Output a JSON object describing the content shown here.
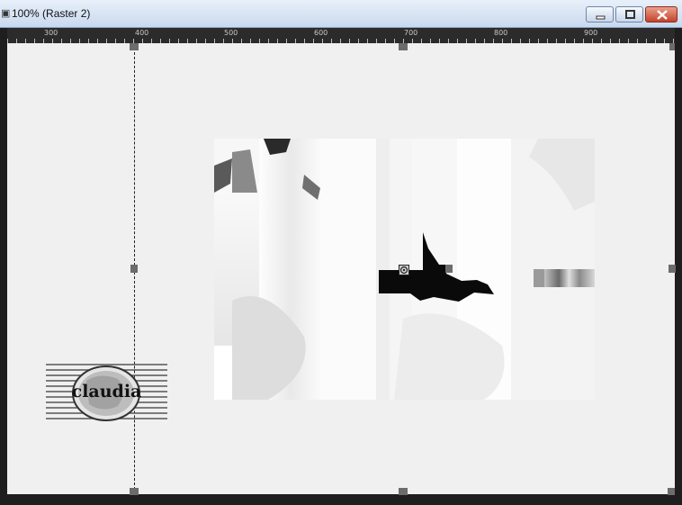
{
  "window": {
    "title": "100% (Raster 2)",
    "icons": {
      "app": "app-icon",
      "minimize": "minimize-icon",
      "maximize": "maximize-icon",
      "close": "close-icon"
    }
  },
  "ruler": {
    "labels": [
      "300",
      "400",
      "500",
      "600",
      "700",
      "800",
      "900"
    ]
  },
  "canvas": {
    "background": "#f0f0f0",
    "layer_image": "abstract-grayscale-art",
    "watermark_text": "claudia"
  },
  "colors": {
    "titlebar": "#c9d9ee",
    "frame": "#1e1e1e",
    "close_button": "#c4432a"
  }
}
